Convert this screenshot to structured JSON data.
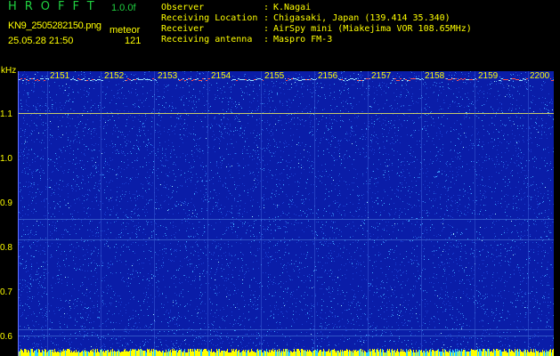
{
  "header": {
    "app_name": "HROFFT",
    "version": "1.0.0f",
    "file_name": "KN9_2505282150.png",
    "mode": "meteor",
    "datetime": "25.05.28 21:50",
    "count": "121"
  },
  "info": [
    {
      "key": "Observer",
      "value": "K.Nagai"
    },
    {
      "key": "Receiving Location",
      "value": "Chigasaki, Japan (139.414 35.340)"
    },
    {
      "key": "Receiver",
      "value": "AirSpy mini (Miakejima VOR 108.65MHz)"
    },
    {
      "key": "Receiving antenna",
      "value": "Maspro FM-3"
    }
  ],
  "separator": ":",
  "plot": {
    "y_unit": "kHz",
    "y_ticks": [
      "1.1",
      "1.0",
      "0.9",
      "0.8",
      "0.7",
      "0.6"
    ],
    "x_ticks": [
      "2151",
      "2152",
      "2153",
      "2154",
      "2155",
      "2156",
      "2157",
      "2158",
      "2159",
      "2200"
    ],
    "colors": {
      "background": "#0a1da8",
      "noise": "#3fa8ff",
      "line": "#e8e860",
      "bottom_band": "#ffff00"
    }
  }
}
